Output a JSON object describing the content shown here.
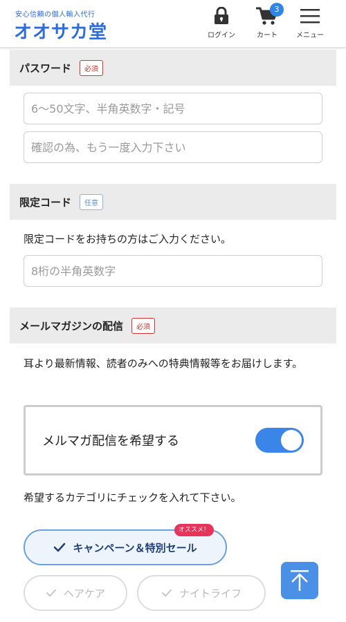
{
  "header": {
    "tagline": "安心信頼の個人輸入代行",
    "brand": "オオサカ堂",
    "login": "ログイン",
    "cart": "カート",
    "cart_count": "3",
    "menu": "メニュー"
  },
  "password": {
    "title": "パスワード",
    "badge": "必須",
    "placeholder": "6〜50文字、半角英数字・記号",
    "confirm_placeholder": "確認の為、もう一度入力下さい"
  },
  "promo_code": {
    "title": "限定コード",
    "badge": "任意",
    "description": "限定コードをお持ちの方はご入力ください。",
    "placeholder": "8桁の半角英数字"
  },
  "newsletter": {
    "title": "メールマガジンの配信",
    "badge": "必須",
    "description": "耳より最新情報、読者のみへの特典情報等をお届けします。",
    "toggle_label": "メルマガ配信を希望する",
    "toggle_on": true,
    "category_instruction": "希望するカテゴリにチェックを入れて下さい。",
    "recommend_badge": "オススメ！",
    "categories": [
      {
        "label": "キャンペーン＆特別セール",
        "checked": true
      },
      {
        "label": "ヘアケア",
        "checked": false
      },
      {
        "label": "ナイトライフ",
        "checked": false
      }
    ]
  },
  "colors": {
    "accent": "#2d6cdf",
    "required": "#d6342b",
    "toggle": "#3a86e8"
  },
  "icons": {
    "login": "lock-icon",
    "cart": "cart-icon",
    "menu": "hamburger-icon",
    "check": "check-icon",
    "to_top": "arrow-up-icon"
  }
}
